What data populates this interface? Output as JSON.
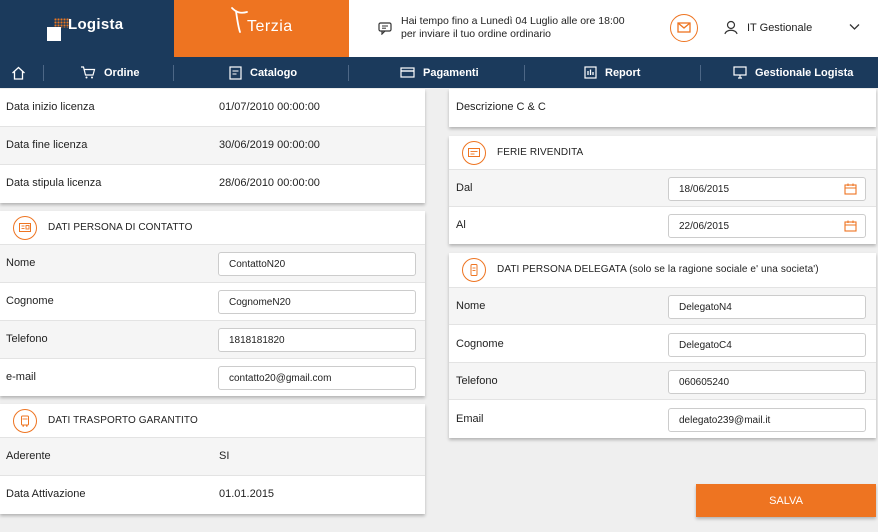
{
  "header": {
    "logo_logista": "Logista",
    "logo_terzia": "Terzia",
    "message_line1": "Hai tempo fino a Lunedì 04 Luglio alle ore 18:00",
    "message_line2": "per inviare il tuo ordine ordinario",
    "user_name": "IT Gestionale",
    "icons": [
      "chat-icon",
      "mail-icon",
      "user-icon",
      "chevron-down-icon"
    ]
  },
  "nav": {
    "home_icon": "home-icon",
    "items": [
      {
        "label": "Ordine",
        "icon": "cart-icon"
      },
      {
        "label": "Catalogo",
        "icon": "document-icon"
      },
      {
        "label": "Pagamenti",
        "icon": "card-icon"
      },
      {
        "label": "Report",
        "icon": "report-icon"
      },
      {
        "label": "Gestionale Logista",
        "icon": "monitor-icon"
      }
    ]
  },
  "license": [
    {
      "label": "Data inizio licenza",
      "value": "01/07/2010 00:00:00"
    },
    {
      "label": "Data fine licenza",
      "value": "30/06/2019 00:00:00"
    },
    {
      "label": "Data stipula licenza",
      "value": "28/06/2010 00:00:00"
    }
  ],
  "contact": {
    "title": "DATI PERSONA DI CONTATTO",
    "fields": [
      {
        "label": "Nome",
        "value": "ContattoN20"
      },
      {
        "label": "Cognome",
        "value": "CognomeN20"
      },
      {
        "label": "Telefono",
        "value": "1818181820"
      },
      {
        "label": "e-mail",
        "value": "contatto20@gmail.com"
      }
    ]
  },
  "transport": {
    "title": "DATI TRASPORTO GARANTITO",
    "fields": [
      {
        "label": "Aderente",
        "value": "SI"
      },
      {
        "label": "Data Attivazione",
        "value": "01.01.2015"
      }
    ]
  },
  "cc": {
    "label": "Descrizione C & C"
  },
  "holidays": {
    "title": "FERIE RIVENDITA",
    "fields": [
      {
        "label": "Dal",
        "value": "18/06/2015"
      },
      {
        "label": "Al",
        "value": "22/06/2015"
      }
    ]
  },
  "delegate": {
    "title": "DATI PERSONA DELEGATA (solo se la ragione sociale e' una societa')",
    "fields": [
      {
        "label": "Nome",
        "value": "DelegatoN4"
      },
      {
        "label": "Cognome",
        "value": "DelegatoC4"
      },
      {
        "label": "Telefono",
        "value": "060605240"
      },
      {
        "label": "Email",
        "value": "delegato239@mail.it"
      }
    ]
  },
  "actions": {
    "save_label": "SALVA"
  },
  "colors": {
    "navy": "#1b3a5c",
    "orange": "#ee7421"
  }
}
